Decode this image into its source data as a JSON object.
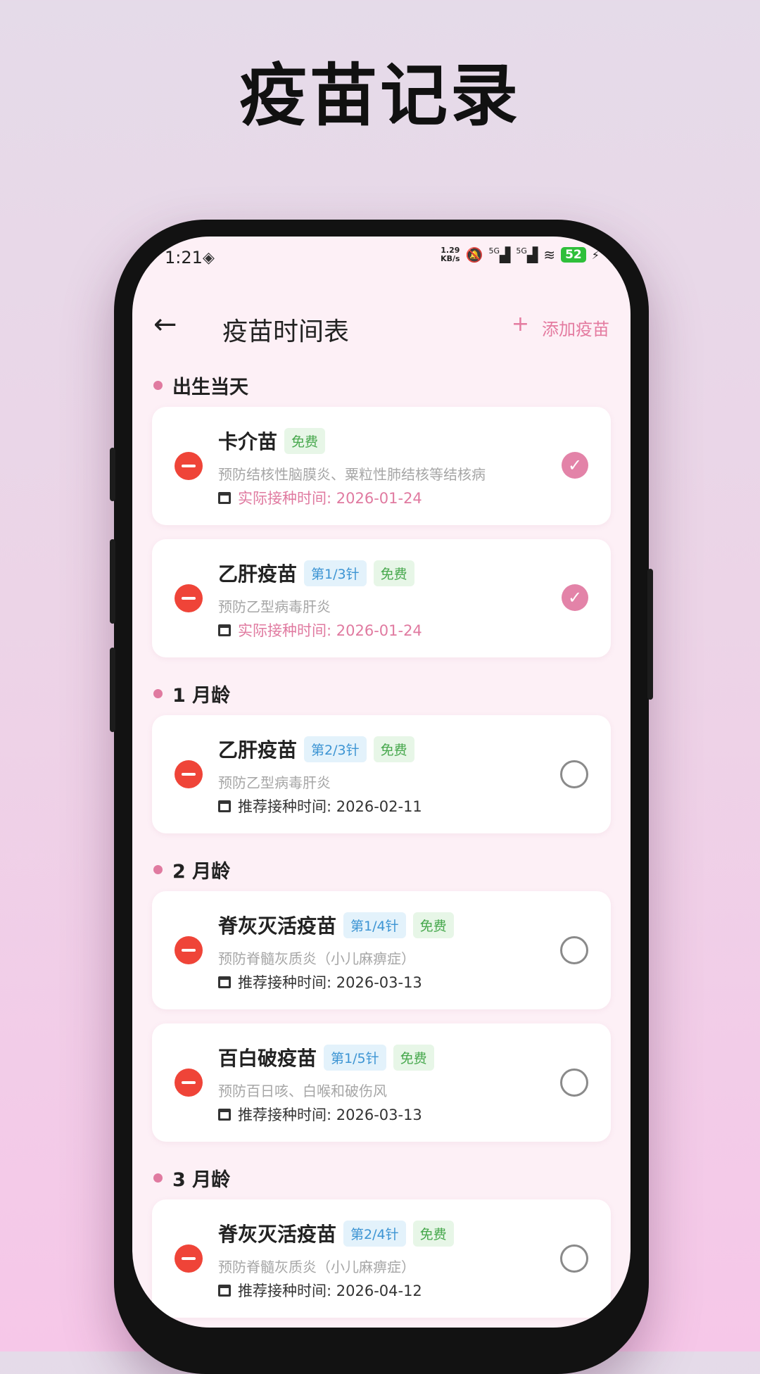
{
  "page_title": "疫苗记录",
  "status_bar": {
    "time": "1:21",
    "nfc_icon": "nfc-icon",
    "net_speed_value": "1.29",
    "net_speed_unit": "KB/s",
    "signal1": "5G",
    "signal2": "5G",
    "battery": "52"
  },
  "appbar": {
    "title": "疫苗时间表",
    "add_label": "添加疫苗",
    "add_icon": "+",
    "back_icon": "←"
  },
  "colors": {
    "accent": "#e07aa0",
    "remove": "#ef4438",
    "dose_tag": "#3c94d3",
    "free_tag": "#47a84d"
  },
  "sections": [
    {
      "title": "出生当天",
      "items": [
        {
          "name": "卡介苗",
          "dose": "",
          "free": "免费",
          "desc": "预防结核性脑膜炎、粟粒性肺结核等结核病",
          "date": "实际接种时间: 2026-01-24",
          "done": true
        },
        {
          "name": "乙肝疫苗",
          "dose": "第1/3针",
          "free": "免费",
          "desc": "预防乙型病毒肝炎",
          "date": "实际接种时间: 2026-01-24",
          "done": true
        }
      ]
    },
    {
      "title": "1 月龄",
      "items": [
        {
          "name": "乙肝疫苗",
          "dose": "第2/3针",
          "free": "免费",
          "desc": "预防乙型病毒肝炎",
          "date": "推荐接种时间: 2026-02-11",
          "done": false
        }
      ]
    },
    {
      "title": "2 月龄",
      "items": [
        {
          "name": "脊灰灭活疫苗",
          "dose": "第1/4针",
          "free": "免费",
          "desc": "预防脊髓灰质炎（小儿麻痹症）",
          "date": "推荐接种时间: 2026-03-13",
          "done": false
        },
        {
          "name": "百白破疫苗",
          "dose": "第1/5针",
          "free": "免费",
          "desc": "预防百日咳、白喉和破伤风",
          "date": "推荐接种时间: 2026-03-13",
          "done": false
        }
      ]
    },
    {
      "title": "3 月龄",
      "items": [
        {
          "name": "脊灰灭活疫苗",
          "dose": "第2/4针",
          "free": "免费",
          "desc": "预防脊髓灰质炎（小儿麻痹症）",
          "date": "推荐接种时间: 2026-04-12",
          "done": false
        }
      ]
    }
  ]
}
